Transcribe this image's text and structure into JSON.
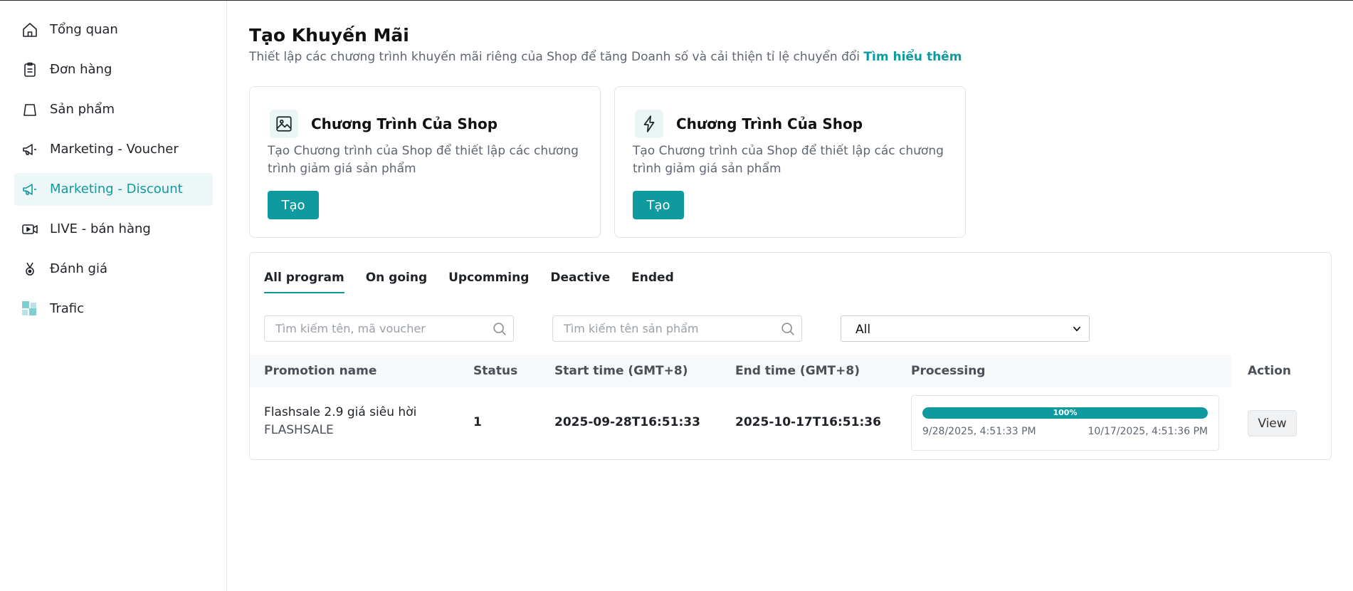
{
  "sidebar": {
    "items": [
      {
        "label": "Tổng quan",
        "icon": "home-icon"
      },
      {
        "label": "Đơn hàng",
        "icon": "clipboard-icon"
      },
      {
        "label": "Sản phẩm",
        "icon": "shopping-bag-icon"
      },
      {
        "label": "Marketing - Voucher",
        "icon": "megaphone-icon"
      },
      {
        "label": "Marketing - Discount",
        "icon": "megaphone-icon",
        "active": true
      },
      {
        "label": "LIVE - bán hàng",
        "icon": "live-video-icon"
      },
      {
        "label": "Đánh giá",
        "icon": "medal-icon"
      },
      {
        "label": "Trafic",
        "icon": "grid-icon"
      }
    ]
  },
  "header": {
    "title": "Tạo Khuyến Mãi",
    "subtitle": "Thiết lập các chương trình khuyến mãi riêng của Shop để tăng Doanh số và cải thiện tỉ lệ chuyển đổi",
    "learn_more": "Tìm hiểu thêm"
  },
  "cards": [
    {
      "title": "Chương Trình Của Shop",
      "description": "Tạo Chương trình của Shop để thiết lập các chương trình giảm giá sản phẩm",
      "button": "Tạo",
      "icon": "image-icon"
    },
    {
      "title": "Chương Trình Của Shop",
      "description": "Tạo Chương trình của Shop để thiết lập các chương trình giảm giá sản phẩm",
      "button": "Tạo",
      "icon": "lightning-icon"
    }
  ],
  "tabs": [
    {
      "label": "All program",
      "active": true
    },
    {
      "label": "On going"
    },
    {
      "label": "Upcomming"
    },
    {
      "label": "Deactive"
    },
    {
      "label": "Ended"
    }
  ],
  "filters": {
    "search_voucher_placeholder": "Tìm kiếm tên, mã voucher",
    "search_product_placeholder": "Tìm kiếm tên sản phẩm",
    "select_value": "All"
  },
  "table": {
    "columns": {
      "name": "Promotion name",
      "status": "Status",
      "start": "Start time (GMT+8)",
      "end": "End time (GMT+8)",
      "processing": "Processing",
      "action": "Action"
    },
    "rows": [
      {
        "name": "Flashsale 2.9 giá siêu hời",
        "code": "FLASHSALE",
        "status": "1",
        "start": "2025-09-28T16:51:33",
        "end": "2025-10-17T16:51:36",
        "progress_percent": 100,
        "progress_label": "100%",
        "progress_start": "9/28/2025, 4:51:33 PM",
        "progress_end": "10/17/2025, 4:51:36 PM",
        "action": "View"
      }
    ]
  },
  "colors": {
    "accent": "#0f9aa0",
    "active_bg": "#eef7f7"
  }
}
